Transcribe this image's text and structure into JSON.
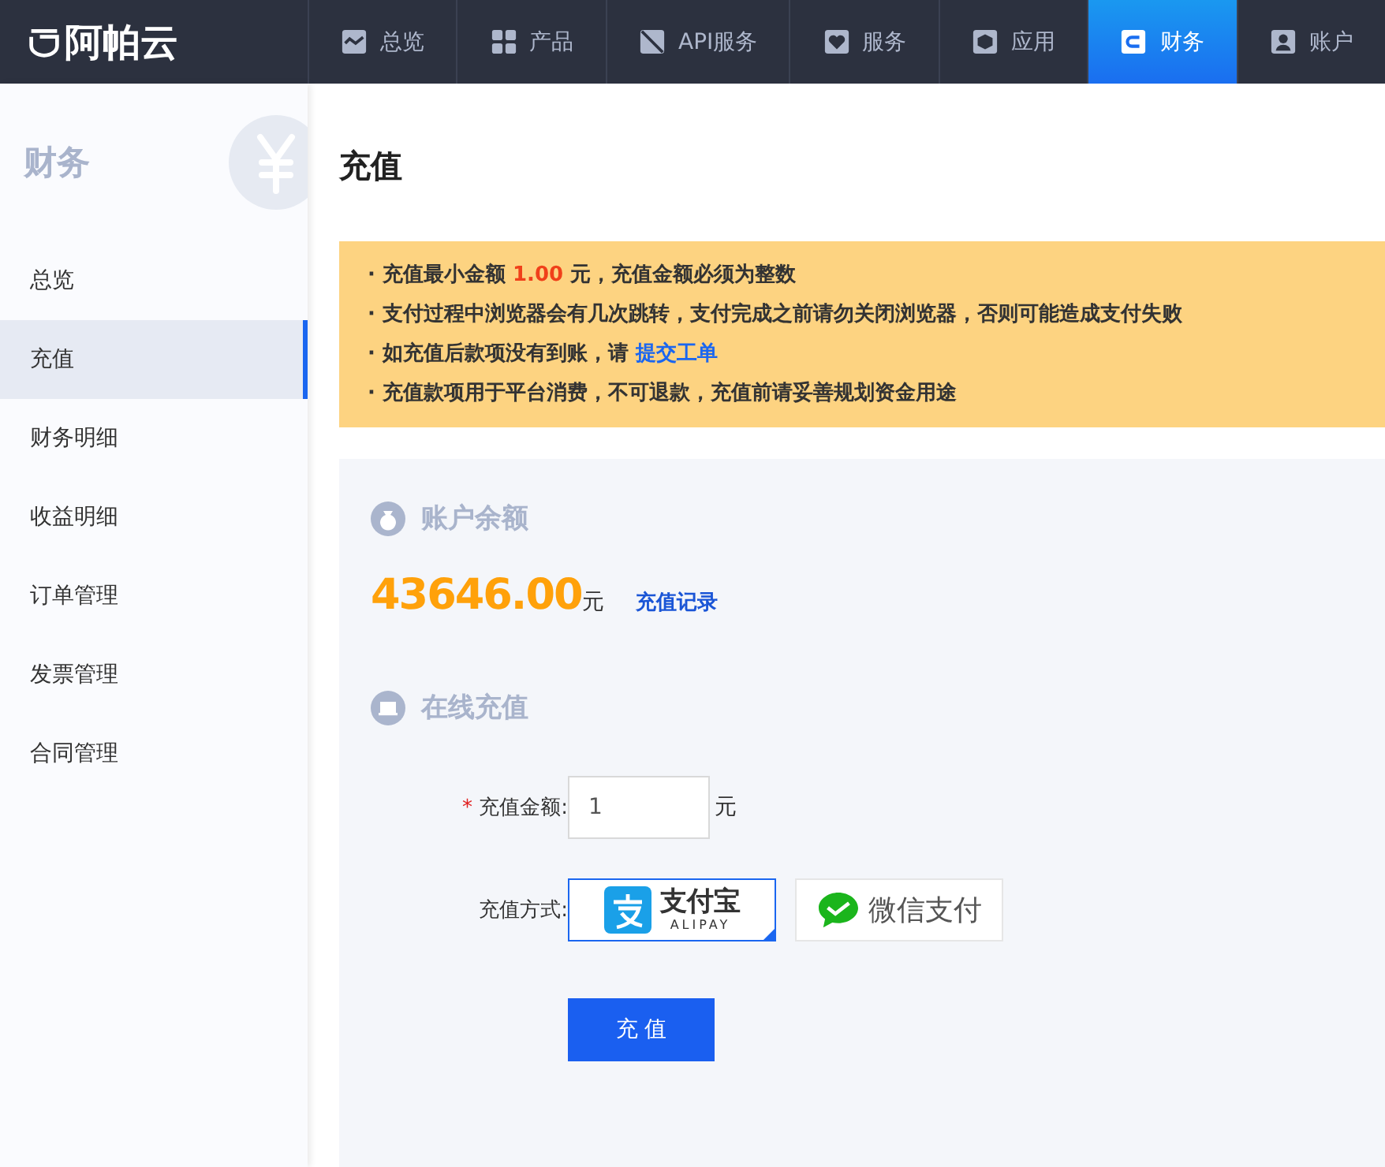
{
  "brand": {
    "name": "阿帕云"
  },
  "nav": [
    {
      "label": "总览",
      "selected": false
    },
    {
      "label": "产品",
      "selected": false
    },
    {
      "label": "API服务",
      "selected": false
    },
    {
      "label": "服务",
      "selected": false
    },
    {
      "label": "应用",
      "selected": false
    },
    {
      "label": "财务",
      "selected": true
    },
    {
      "label": "账户",
      "selected": false
    }
  ],
  "sidebar": {
    "title": "财务",
    "items": [
      {
        "label": "总览",
        "selected": false
      },
      {
        "label": "充值",
        "selected": true
      },
      {
        "label": "财务明细",
        "selected": false
      },
      {
        "label": "收益明细",
        "selected": false
      },
      {
        "label": "订单管理",
        "selected": false
      },
      {
        "label": "发票管理",
        "selected": false
      },
      {
        "label": "合同管理",
        "selected": false
      }
    ]
  },
  "page": {
    "title": "充值"
  },
  "notices": [
    [
      {
        "kind": "text",
        "text": "· 充值最小金额 "
      },
      {
        "kind": "highlight",
        "text": "1.00"
      },
      {
        "kind": "text",
        "text": " 元，充值金额必须为整数"
      }
    ],
    [
      {
        "kind": "text",
        "text": "· 支付过程中浏览器会有几次跳转，支付完成之前请勿关闭浏览器，否则可能造成支付失败"
      }
    ],
    [
      {
        "kind": "text",
        "text": "· 如充值后款项没有到账，请 "
      },
      {
        "kind": "link",
        "text": "提交工单"
      }
    ],
    [
      {
        "kind": "text",
        "text": "· 充值款项用于平台消费，不可退款，充值前请妥善规划资金用途"
      }
    ]
  ],
  "balance": {
    "heading": "账户余额",
    "amount": "43646.00",
    "unit": "元",
    "link": "充值记录"
  },
  "recharge": {
    "heading": "在线充值",
    "required_mark": "*",
    "amount_label": "充值金额:",
    "amount_value": "1",
    "amount_unit": "元",
    "method_label": "充值方式:",
    "methods": [
      {
        "kind": "alipay",
        "name": "支付宝",
        "subname": "ALIPAY",
        "selected": true
      },
      {
        "kind": "wechat",
        "name": "微信支付",
        "selected": false
      }
    ],
    "submit": "充 值"
  }
}
